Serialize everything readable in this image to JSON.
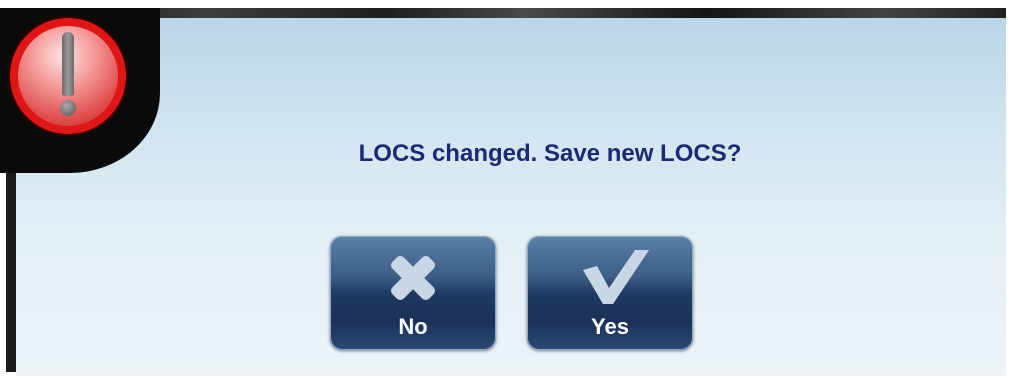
{
  "dialog": {
    "message": "LOCS changed. Save new LOCS?",
    "icon": "warning-exclamation-icon",
    "accent_color": "#1c2a75"
  },
  "buttons": {
    "no": {
      "label": "No",
      "icon": "x-cross-icon"
    },
    "yes": {
      "label": "Yes",
      "icon": "checkmark-icon"
    }
  }
}
